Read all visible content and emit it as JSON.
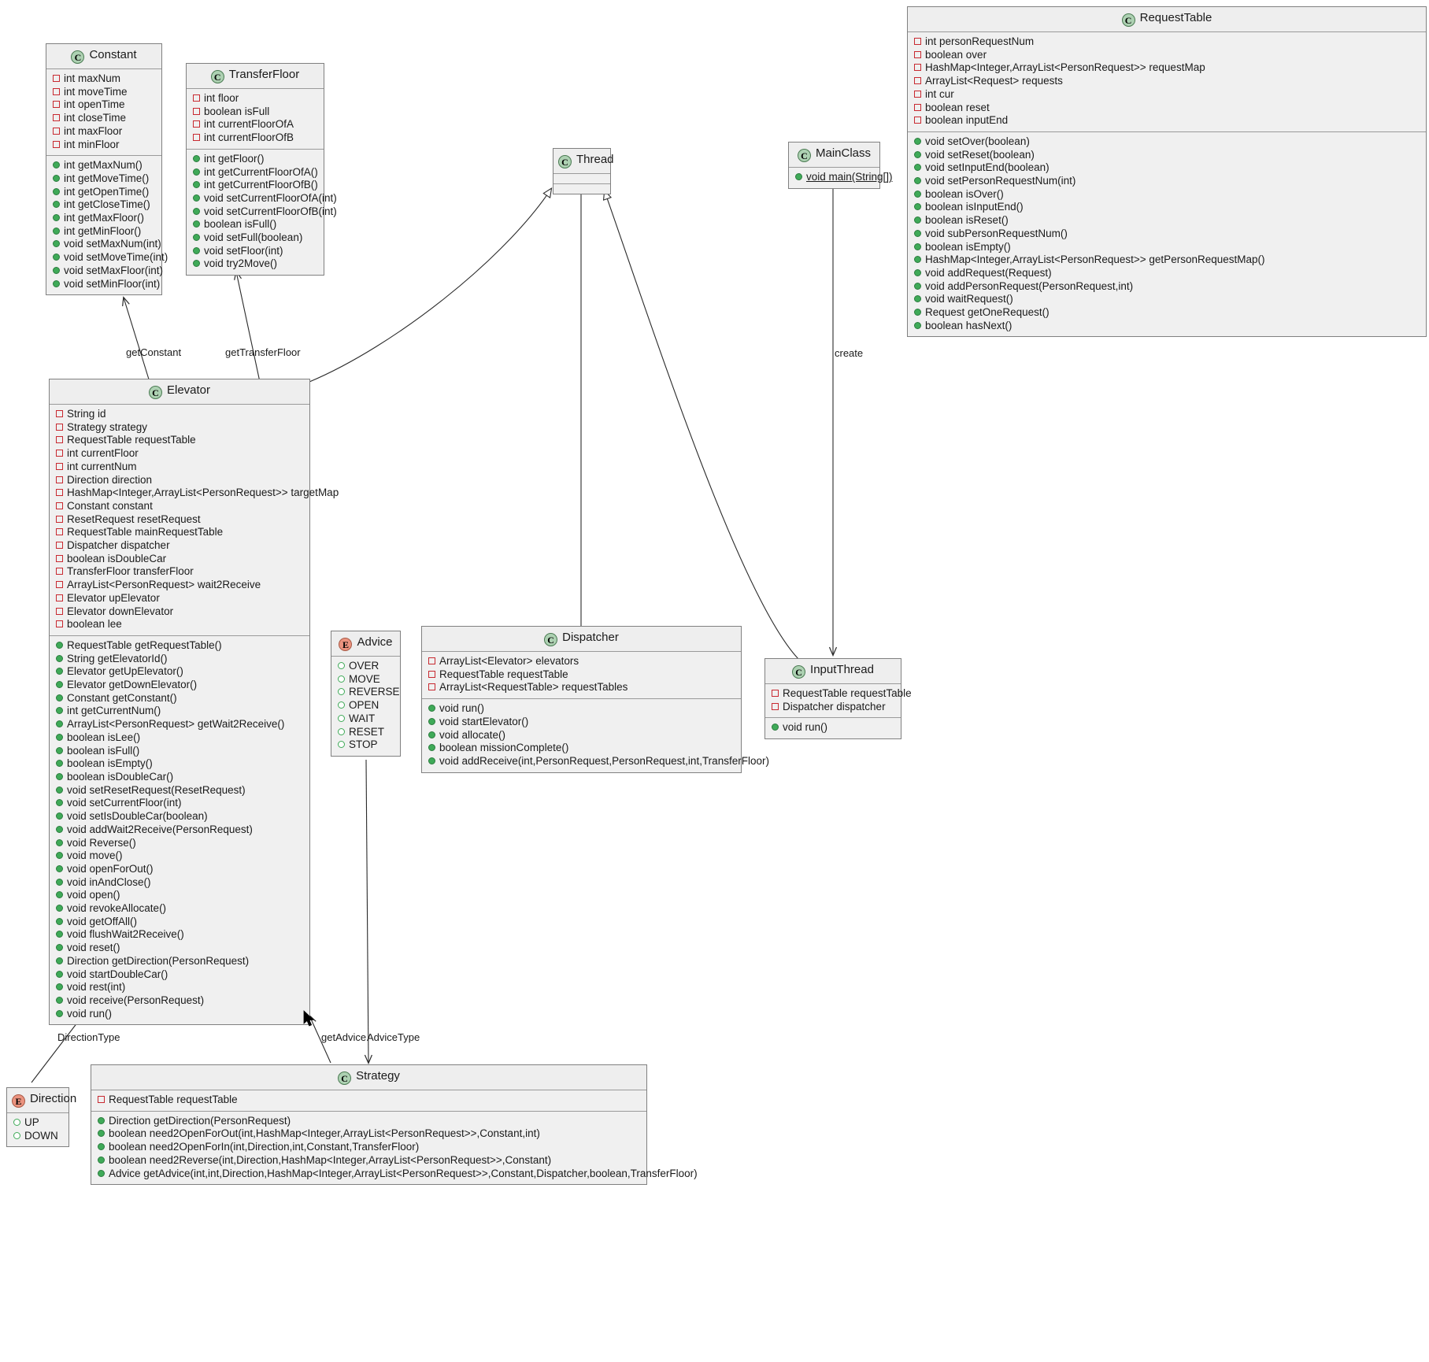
{
  "diagram": {
    "type": "uml-class-diagram",
    "background": "#ffffff",
    "colors": {
      "class_badge": "#ADD1B2",
      "enum_badge": "#EB937F",
      "private_marker": "#C82930",
      "public_marker": "#3FAA58",
      "box_fill": "#f0f0f0",
      "box_border": "#808080"
    }
  },
  "classes": {
    "constant": {
      "name": "Constant",
      "stereotype": "C",
      "fields": [
        "int maxNum",
        "int moveTime",
        "int openTime",
        "int closeTime",
        "int maxFloor",
        "int minFloor"
      ],
      "methods": [
        "int getMaxNum()",
        "int getMoveTime()",
        "int getOpenTime()",
        "int getCloseTime()",
        "int getMaxFloor()",
        "int getMinFloor()",
        "void setMaxNum(int)",
        "void setMoveTime(int)",
        "void setMaxFloor(int)",
        "void setMinFloor(int)"
      ]
    },
    "transfer_floor": {
      "name": "TransferFloor",
      "stereotype": "C",
      "fields": [
        "int floor",
        "boolean isFull",
        "int currentFloorOfA",
        "int currentFloorOfB"
      ],
      "methods": [
        "int getFloor()",
        "int getCurrentFloorOfA()",
        "int getCurrentFloorOfB()",
        "void setCurrentFloorOfA(int)",
        "void setCurrentFloorOfB(int)",
        "boolean isFull()",
        "void setFull(boolean)",
        "void setFloor(int)",
        "void try2Move()"
      ]
    },
    "thread": {
      "name": "Thread",
      "stereotype": "C",
      "fields": [],
      "methods": []
    },
    "main_class": {
      "name": "MainClass",
      "stereotype": "C",
      "fields": [],
      "methods": [
        "void main(String[])"
      ],
      "static_methods": [
        "void main(String[])"
      ]
    },
    "request_table": {
      "name": "RequestTable",
      "stereotype": "C",
      "fields": [
        "int personRequestNum",
        "boolean over",
        "HashMap<Integer,ArrayList<PersonRequest>> requestMap",
        "ArrayList<Request> requests",
        "int cur",
        "boolean reset",
        "boolean inputEnd"
      ],
      "methods": [
        "void setOver(boolean)",
        "void setReset(boolean)",
        "void setInputEnd(boolean)",
        "void setPersonRequestNum(int)",
        "boolean isOver()",
        "boolean isInputEnd()",
        "boolean isReset()",
        "void subPersonRequestNum()",
        "boolean isEmpty()",
        "HashMap<Integer,ArrayList<PersonRequest>> getPersonRequestMap()",
        "void addRequest(Request)",
        "void addPersonRequest(PersonRequest,int)",
        "void waitRequest()",
        "Request getOneRequest()",
        "boolean hasNext()"
      ]
    },
    "elevator": {
      "name": "Elevator",
      "stereotype": "C",
      "fields": [
        "String id",
        "Strategy strategy",
        "RequestTable requestTable",
        "int currentFloor",
        "int currentNum",
        "Direction direction",
        "HashMap<Integer,ArrayList<PersonRequest>> targetMap",
        "Constant constant",
        "ResetRequest resetRequest",
        "RequestTable mainRequestTable",
        "Dispatcher dispatcher",
        "boolean isDoubleCar",
        "TransferFloor transferFloor",
        "ArrayList<PersonRequest> wait2Receive",
        "Elevator upElevator",
        "Elevator downElevator",
        "boolean lee"
      ],
      "methods": [
        "RequestTable getRequestTable()",
        "String getElevatorId()",
        "Elevator getUpElevator()",
        "Elevator getDownElevator()",
        "Constant getConstant()",
        "int getCurrentNum()",
        "ArrayList<PersonRequest> getWait2Receive()",
        "boolean isLee()",
        "boolean isFull()",
        "boolean isEmpty()",
        "boolean isDoubleCar()",
        "void setResetRequest(ResetRequest)",
        "void setCurrentFloor(int)",
        "void setIsDoubleCar(boolean)",
        "void addWait2Receive(PersonRequest)",
        "void Reverse()",
        "void move()",
        "void openForOut()",
        "void inAndClose()",
        "void open()",
        "void revokeAllocate()",
        "void getOffAll()",
        "void flushWait2Receive()",
        "void reset()",
        "Direction getDirection(PersonRequest)",
        "void startDoubleCar()",
        "void rest(int)",
        "void receive(PersonRequest)",
        "void run()"
      ]
    },
    "advice": {
      "name": "Advice",
      "stereotype": "E",
      "values": [
        "OVER",
        "MOVE",
        "REVERSE",
        "OPEN",
        "WAIT",
        "RESET",
        "STOP"
      ]
    },
    "dispatcher": {
      "name": "Dispatcher",
      "stereotype": "C",
      "fields": [
        "ArrayList<Elevator> elevators",
        "RequestTable requestTable",
        "ArrayList<RequestTable> requestTables"
      ],
      "methods": [
        "void run()",
        "void startElevator()",
        "void allocate()",
        "boolean missionComplete()",
        "void addReceive(int,PersonRequest,PersonRequest,int,TransferFloor)"
      ]
    },
    "input_thread": {
      "name": "InputThread",
      "stereotype": "C",
      "fields": [
        "RequestTable requestTable",
        "Dispatcher dispatcher"
      ],
      "methods": [
        "void run()"
      ]
    },
    "direction": {
      "name": "Direction",
      "stereotype": "E",
      "values": [
        "UP",
        "DOWN"
      ]
    },
    "strategy": {
      "name": "Strategy",
      "stereotype": "C",
      "fields": [
        "RequestTable requestTable"
      ],
      "methods": [
        "Direction getDirection(PersonRequest)",
        "boolean need2OpenForOut(int,HashMap<Integer,ArrayList<PersonRequest>>,Constant,int)",
        "boolean need2OpenForIn(int,Direction,int,Constant,TransferFloor)",
        "boolean need2Reverse(int,Direction,HashMap<Integer,ArrayList<PersonRequest>>,Constant)",
        "Advice getAdvice(int,int,Direction,HashMap<Integer,ArrayList<PersonRequest>>,Constant,Dispatcher,boolean,TransferFloor)"
      ]
    }
  },
  "edge_labels": {
    "get_constant": "getConstant",
    "get_transfer_floor": "getTransferFloor",
    "create": "create",
    "direction_type": "DirectionType",
    "get_advice": "getAdvice",
    "advice_type": "AdviceType"
  }
}
